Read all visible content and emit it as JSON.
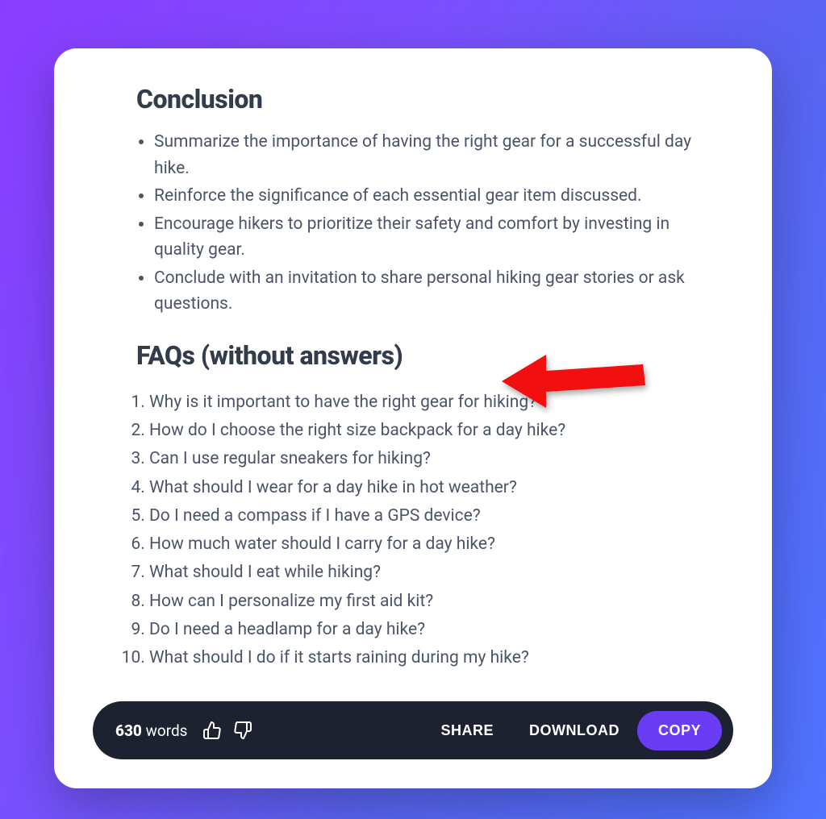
{
  "conclusion": {
    "title": "Conclusion",
    "items": [
      "Summarize the importance of having the right gear for a successful day hike.",
      "Reinforce the significance of each essential gear item discussed.",
      "Encourage hikers to prioritize their safety and comfort by investing in quality gear.",
      "Conclude with an invitation to share personal hiking gear stories or ask questions."
    ]
  },
  "faqs": {
    "title": "FAQs (without answers)",
    "items": [
      "Why is it important to have the right gear for hiking?",
      "How do I choose the right size backpack for a day hike?",
      "Can I use regular sneakers for hiking?",
      "What should I wear for a day hike in hot weather?",
      "Do I need a compass if I have a GPS device?",
      "How much water should I carry for a day hike?",
      "What should I eat while hiking?",
      "How can I personalize my first aid kit?",
      "Do I need a headlamp for a day hike?",
      "What should I do if it starts raining during my hike?"
    ]
  },
  "toolbar": {
    "word_count_number": "630",
    "word_count_label": "words",
    "share_label": "SHARE",
    "download_label": "DOWNLOAD",
    "copy_label": "COPY"
  },
  "annotation": {
    "arrow_color": "#F10F0F"
  }
}
